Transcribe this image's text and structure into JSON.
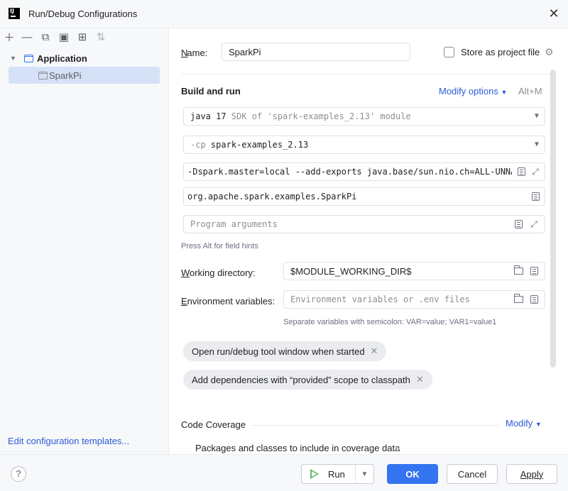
{
  "window": {
    "title": "Run/Debug Configurations",
    "logo_text": "IJ"
  },
  "sidebar": {
    "tree": [
      {
        "label": "Application",
        "expanded": true
      },
      {
        "label": "SparkPi",
        "selected": true
      }
    ],
    "edit_templates_link": "Edit configuration templates..."
  },
  "form": {
    "name_label": "Name:",
    "name_value": "SparkPi",
    "store_label": "Store as project file",
    "store_checked": false,
    "build_run_heading": "Build and run",
    "modify_options_label": "Modify options",
    "modify_options_shortcut": "Alt+M",
    "sdk_java": "java 17",
    "sdk_detail": "SDK of 'spark-examples_2.13' module",
    "cp_flag": "-cp",
    "cp_value": "spark-examples_2.13",
    "vm_options": "-Dspark.master=local --add-exports java.base/sun.nio.ch=ALL-UNNAMED",
    "main_class": "org.apache.spark.examples.SparkPi",
    "program_args_placeholder": "Program arguments",
    "field_hint": "Press Alt for field hints",
    "working_dir_label": "Working directory:",
    "working_dir_value": "$MODULE_WORKING_DIR$",
    "env_label": "Environment variables:",
    "env_placeholder": "Environment variables or .env files",
    "env_hint": "Separate variables with semicolon: VAR=value; VAR1=value1",
    "chips": [
      "Open run/debug tool window when started",
      "Add dependencies with “provided” scope to classpath"
    ],
    "code_coverage_label": "Code Coverage",
    "coverage_modify_label": "Modify",
    "coverage_packages_label": "Packages and classes to include in coverage data"
  },
  "footer": {
    "help_label": "?",
    "run_label": "Run",
    "ok_label": "OK",
    "cancel_label": "Cancel",
    "apply_label": "Apply"
  },
  "colors": {
    "accent": "#3574f0",
    "link": "#2a5bd7",
    "selection": "#d5e1f7",
    "run_green": "#5fb865"
  }
}
